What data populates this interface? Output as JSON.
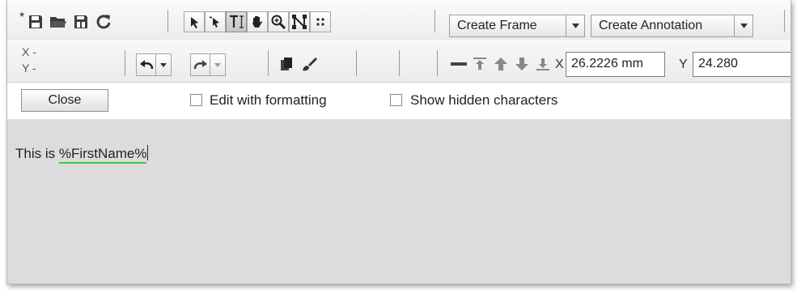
{
  "toolbar_top": {
    "modified_marker": "*",
    "icons": [
      "save-icon",
      "open-folder-icon",
      "save-as-icon",
      "refresh-icon"
    ],
    "tools": [
      "select-arrow-icon",
      "direct-select-icon",
      "text-tool-icon",
      "hand-pan-icon",
      "zoom-icon",
      "node-edit-icon",
      "grid-dots-icon"
    ],
    "active_tool": "text-tool-icon",
    "create_frame_label": "Create Frame",
    "create_annotation_label": "Create Annotation"
  },
  "toolbar_mid": {
    "x_label": "X -",
    "y_label": "Y -",
    "undo_icon": "undo-icon",
    "redo_icon": "redo-icon",
    "icons": [
      "copy-icon",
      "paint-brush-icon",
      "line-icon",
      "align-top-icon",
      "arrow-up-icon",
      "arrow-down-icon",
      "align-bottom-icon"
    ],
    "x_field_label": "X",
    "x_value": "26.2226 mm",
    "y_field_label": "Y",
    "y_value": "24.280"
  },
  "options_bar": {
    "close_label": "Close",
    "edit_with_formatting_label": "Edit with formatting",
    "edit_with_formatting_checked": false,
    "show_hidden_label": "Show hidden characters",
    "show_hidden_checked": false
  },
  "editor": {
    "text_prefix": "This is ",
    "variable": "%FirstName%",
    "variable_underline_color": "#3fc84a",
    "background_color": "#dcdcdc"
  }
}
